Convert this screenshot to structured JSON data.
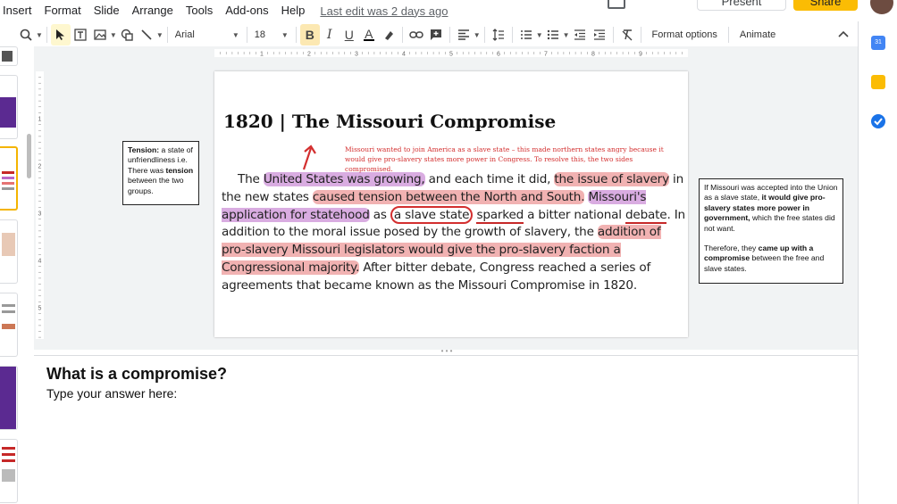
{
  "menu": {
    "items": [
      "Insert",
      "Format",
      "Slide",
      "Arrange",
      "Tools",
      "Add-ons",
      "Help"
    ],
    "last_edit": "Last edit was 2 days ago",
    "present": "Present",
    "share": "Share"
  },
  "toolbar": {
    "font": "Arial",
    "size": "18",
    "format_options": "Format options",
    "animate": "Animate"
  },
  "slide": {
    "title": "1820 | The Missouri Compromise",
    "red_note": "Missouri wanted to join America as a slave state – this made northern states angry because it would give pro-slavery states more power in Congress. To resolve this, the two sides compromised.",
    "body": {
      "p1": "The ",
      "h1": "United States was growing,",
      "p2": " and each time it did, ",
      "h2": "the issue of slavery",
      "p3": " in the new states ",
      "h3": "caused tension between the North and South.",
      "p4": " ",
      "h4": "Missouri's application for statehood",
      "p5": " as ",
      "c1": "a slave state",
      "p6": " ",
      "u1": "sparked",
      "p7": " a bitter national ",
      "u2": "debate",
      "p8": ". In addition to the moral issue posed by the growth of slavery, the ",
      "h5": "addition of pro-slavery Missouri legislators would give the pro-slavery faction a Congressional majority.",
      "p9": " After bitter debate, Congress reached a series of agreements that became known as the Missouri Compromise in 1820."
    }
  },
  "callout_left": {
    "term": "Tension:",
    "text": " a state of unfriendliness i.e. There was ",
    "bold": "tension",
    "text2": " between the two groups."
  },
  "callout_right": {
    "t1": "If Missouri was accepted into the Union as a slave state, ",
    "b1": "it would give pro-slavery states more power in government,",
    "t2": " which the free states did not want.",
    "t3": "Therefore, they ",
    "b2": "came up with a compromise",
    "t4": " between the free and slave states."
  },
  "notes": {
    "question": "What is a compromise?",
    "answer": "Type your answer here:"
  },
  "colors": {
    "share": "#fbbc04",
    "highlight_purple": "#ba68c8",
    "highlight_pink": "#e57373",
    "red_note": "#d32f2f"
  },
  "ruler": {
    "top_labels": [
      "1",
      "2",
      "3",
      "4",
      "5",
      "6",
      "7",
      "8",
      "9"
    ],
    "left_labels": [
      "1",
      "2",
      "3",
      "4",
      "5"
    ]
  }
}
